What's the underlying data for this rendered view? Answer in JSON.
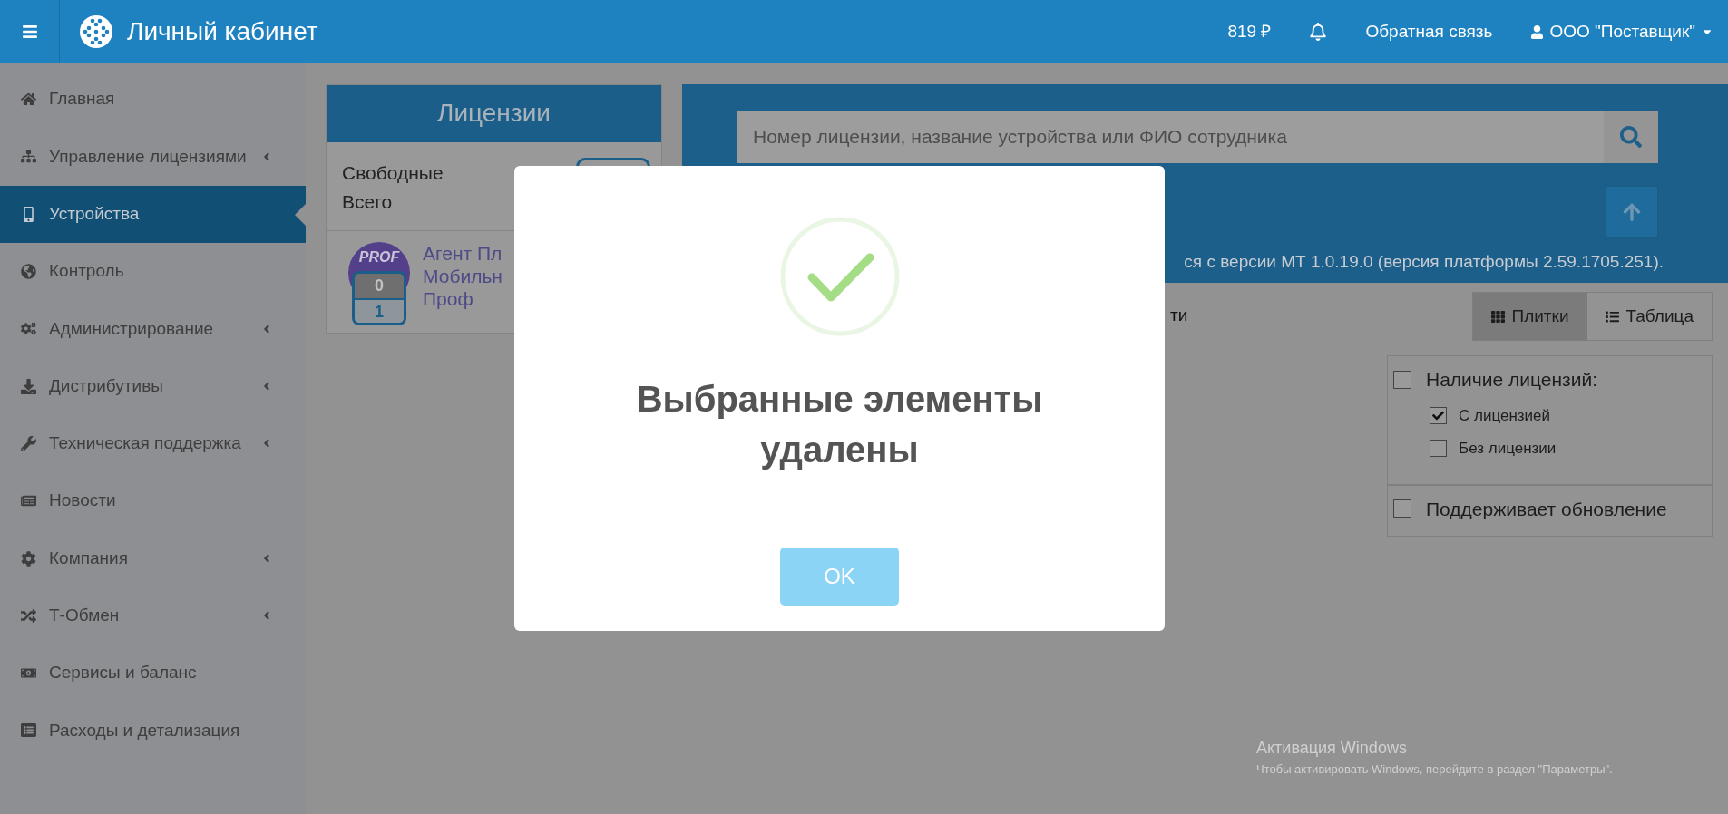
{
  "header": {
    "title": "Личный кабинет",
    "balance": "819 ₽",
    "feedback": "Обратная связь",
    "account": "ООО \"Поставщик\""
  },
  "sidebar": {
    "items": [
      {
        "label": "Главная",
        "has_submenu": false,
        "selected": false
      },
      {
        "label": "Управление лицензиями",
        "has_submenu": true,
        "selected": false
      },
      {
        "label": "Устройства",
        "has_submenu": false,
        "selected": true
      },
      {
        "label": "Контроль",
        "has_submenu": false,
        "selected": false
      },
      {
        "label": "Администрирование",
        "has_submenu": true,
        "selected": false
      },
      {
        "label": "Дистрибутивы",
        "has_submenu": true,
        "selected": false
      },
      {
        "label": "Техническая поддержка",
        "has_submenu": true,
        "selected": false
      },
      {
        "label": "Новости",
        "has_submenu": false,
        "selected": false
      },
      {
        "label": "Компания",
        "has_submenu": true,
        "selected": false
      },
      {
        "label": "Т-Обмен",
        "has_submenu": true,
        "selected": false
      },
      {
        "label": "Сервисы и баланс",
        "has_submenu": false,
        "selected": false
      },
      {
        "label": "Расходы и детализация",
        "has_submenu": false,
        "selected": false
      }
    ]
  },
  "licenses": {
    "title": "Лицензии",
    "summary": [
      "Свободные",
      "Всего"
    ],
    "items": [
      {
        "badge": "PROF",
        "free": "0",
        "total": "1",
        "name_lines": [
          "Агент Пл",
          "Мобильн",
          "Проф"
        ]
      }
    ]
  },
  "search": {
    "placeholder": "Номер лицензии, название устройства или ФИО сотрудника"
  },
  "version_note": "ся с версии МТ 1.0.19.0 (версия платформы 2.59.1705.251).",
  "partial_text": "ти",
  "view_toggle": [
    {
      "label": "Плитки",
      "selected": true
    },
    {
      "label": "Таблица",
      "selected": false
    }
  ],
  "filters": [
    {
      "label": "Наличие лицензий:",
      "checked": false,
      "children": [
        {
          "label": "С лицензией",
          "checked": true
        },
        {
          "label": "Без лицензии",
          "checked": false
        }
      ]
    },
    {
      "label": "Поддерживает обновление",
      "checked": false
    }
  ],
  "modal": {
    "message": "Выбранные элементы удалены",
    "button": "OK"
  },
  "os_notice": {
    "title": "Активация Windows",
    "text": "Чтобы активировать Windows, перейдите в раздел \"Параметры\"."
  }
}
